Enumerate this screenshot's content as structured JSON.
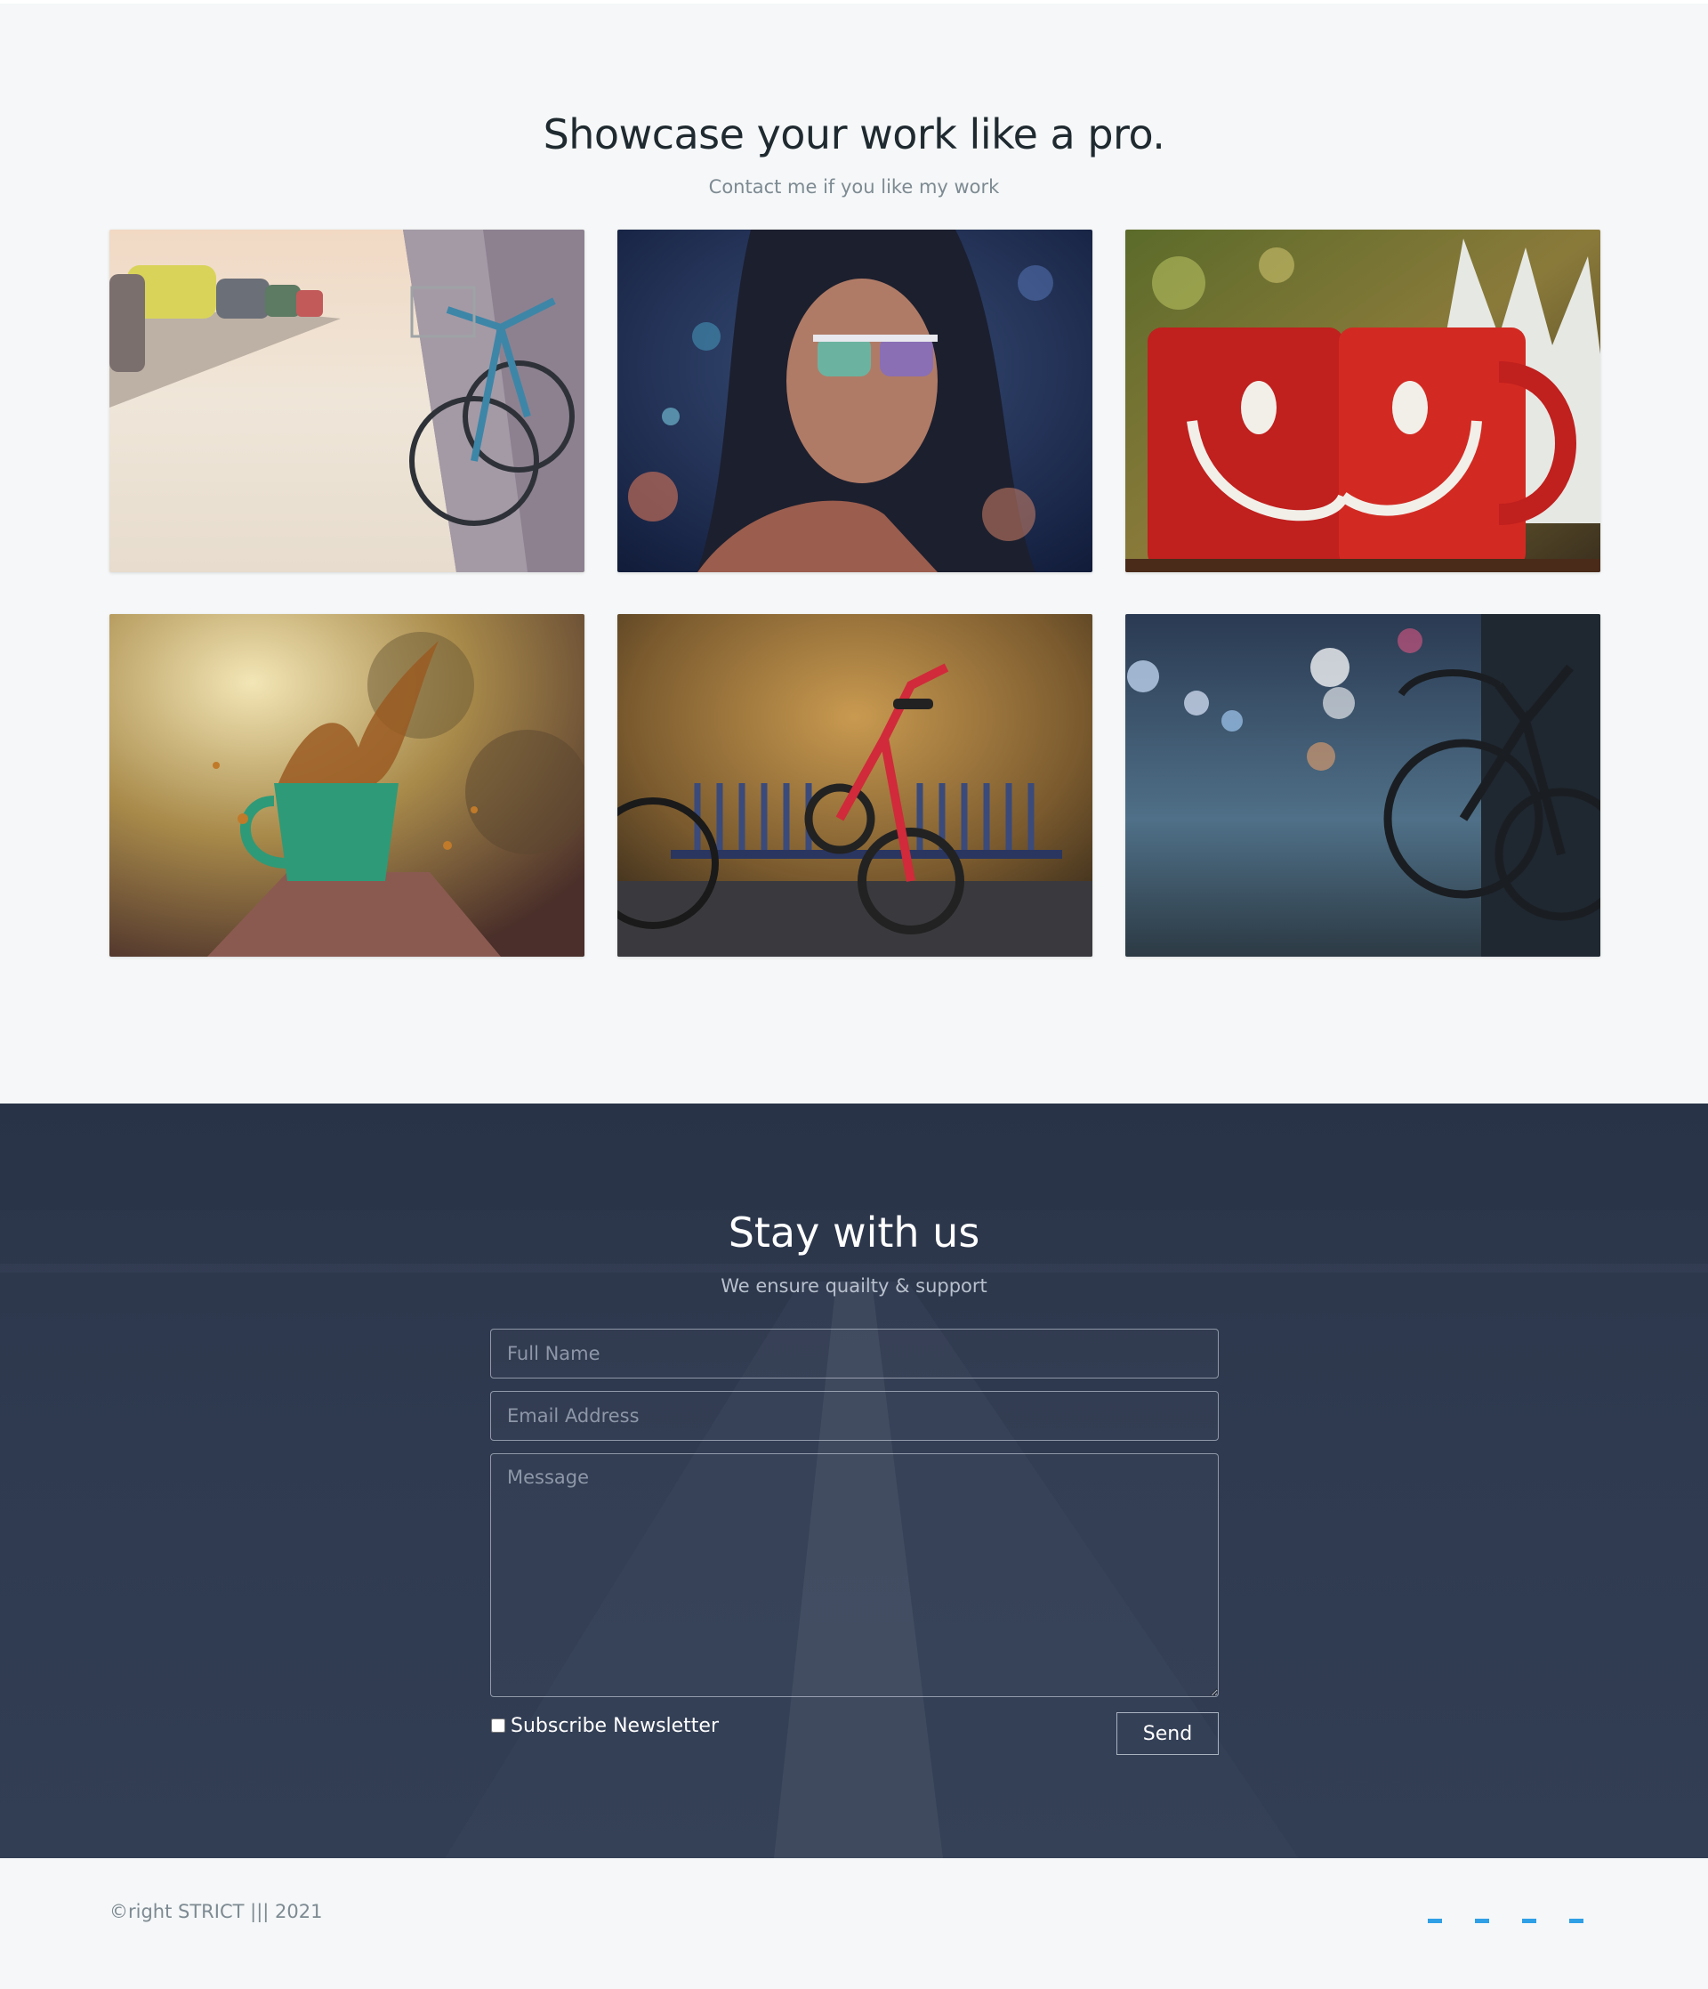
{
  "portfolio": {
    "title": "Showcase your work like a pro.",
    "subtitle": "Contact me if you like my work",
    "items": [
      {
        "subject": "bicycle-street-photo"
      },
      {
        "subject": "woman-sunglasses-bokeh-photo"
      },
      {
        "subject": "red-smiley-mugs-photo"
      },
      {
        "subject": "coffee-splash-cup-photo"
      },
      {
        "subject": "red-bicycle-wall-photo"
      },
      {
        "subject": "bicycle-night-street-photo"
      }
    ]
  },
  "contact": {
    "title": "Stay with us",
    "subtitle": "We ensure quailty & support",
    "name_placeholder": "Full Name",
    "email_placeholder": "Email Address",
    "message_placeholder": "Message",
    "newsletter_label": "Subscribe Newsletter",
    "newsletter_checked": false,
    "send_label": "Send"
  },
  "footer": {
    "copyright": "©right STRICT ||| 2021",
    "social_icons": [
      "social-icon-1",
      "social-icon-2",
      "social-icon-3",
      "social-icon-4"
    ],
    "accent_color": "#2f9fe6"
  }
}
